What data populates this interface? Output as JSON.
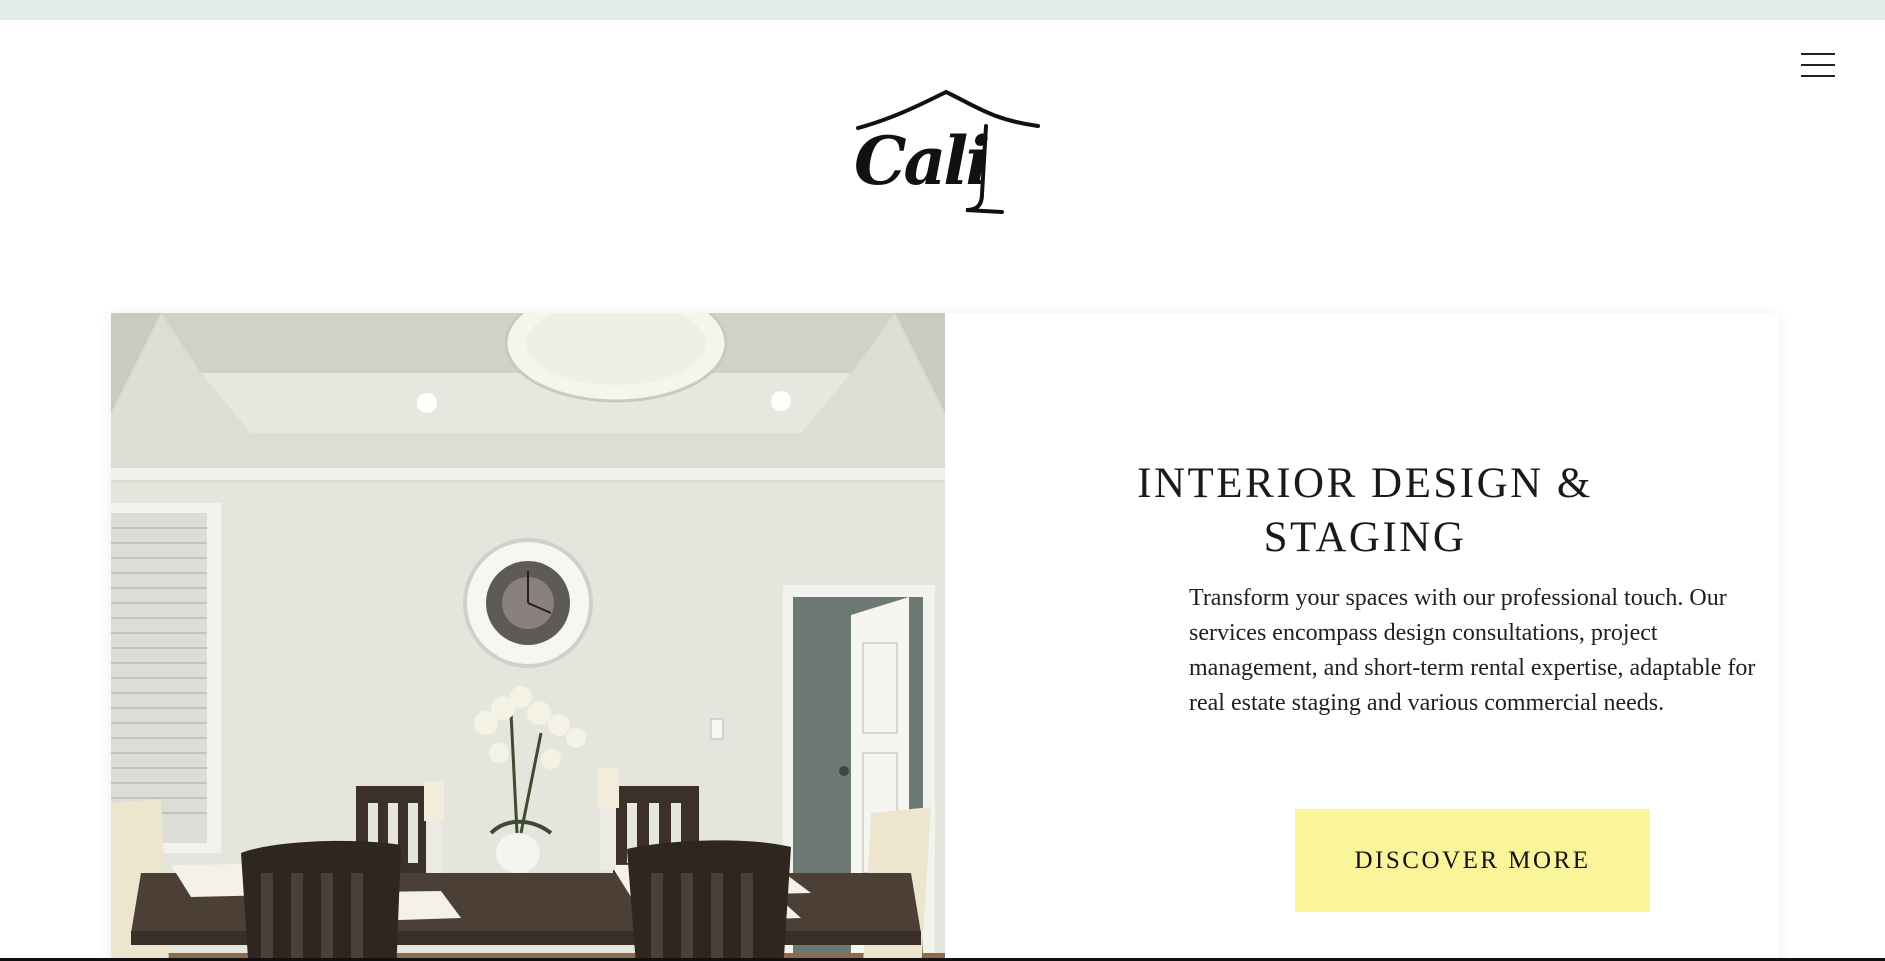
{
  "header": {
    "menu_icon": "hamburger-menu-icon",
    "logo_text": "Cali",
    "logo_icon": "house-roof-icon"
  },
  "hero": {
    "image_description_icon": "dining-room-photo",
    "title": "INTERIOR DESIGN & STAGING",
    "description": "Transform your spaces with our professional touch. Our services encompass design consultations, project management, and short-term rental expertise, adaptable for real estate staging and various commercial needs.",
    "cta_label": "DISCOVER MORE"
  },
  "colors": {
    "top_strip": "#e2ede7",
    "cta_background": "#faf59b",
    "text": "#1a1a1a",
    "wall": "#e4e6dd"
  }
}
